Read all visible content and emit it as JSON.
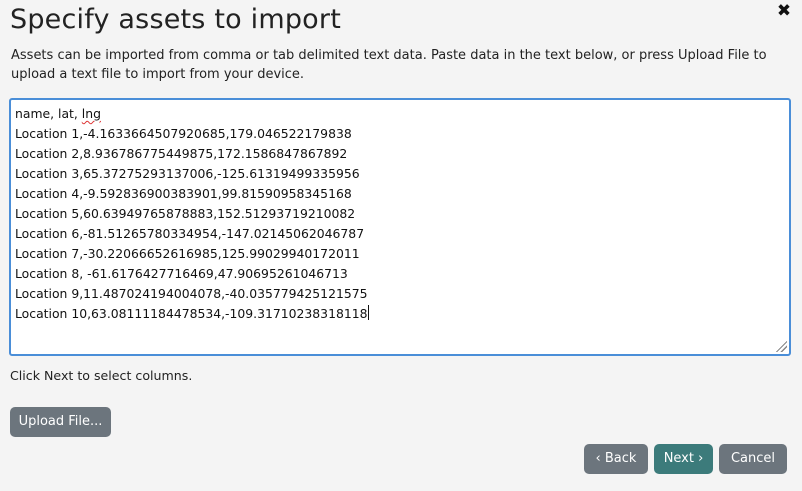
{
  "dialog": {
    "title": "Specify assets to import",
    "close_glyph": "✖",
    "close_icon": "close-icon",
    "description": "Assets can be imported from comma or tab delimited text data. Paste data in the text below, or press Upload File to upload a text file to import from your device.",
    "hint": "Click Next to select columns."
  },
  "editor": {
    "header_prefix": "name, lat, ",
    "header_misspelled": "lng",
    "lines": [
      "Location 1,-4.1633664507920685,179.046522179838",
      "Location 2,8.936786775449875,172.1586847867892",
      "Location 3,65.37275293137006,-125.61319499335956",
      "Location 4,-9.592836900383901,99.81590958345168",
      "Location 5,60.63949765878883,152.51293719210082",
      "Location 6,-81.51265780334954,-147.02145062046787",
      "Location 7,-30.22066652616985,125.99029940172011",
      "Location 8, -61.6176427716469,47.90695261046713",
      "Location 9,11.487024194004078,-40.035779425121575",
      "Location 10,63.08111184478534,-109.31710238318118"
    ]
  },
  "buttons": {
    "upload": "Upload File...",
    "back": "‹ Back",
    "next": "Next ›",
    "cancel": "Cancel"
  },
  "colors": {
    "editor_border": "#4a8ed8",
    "secondary_button": "#6c757d",
    "primary_button": "#3c7b7b",
    "background": "#f4f4f4"
  }
}
